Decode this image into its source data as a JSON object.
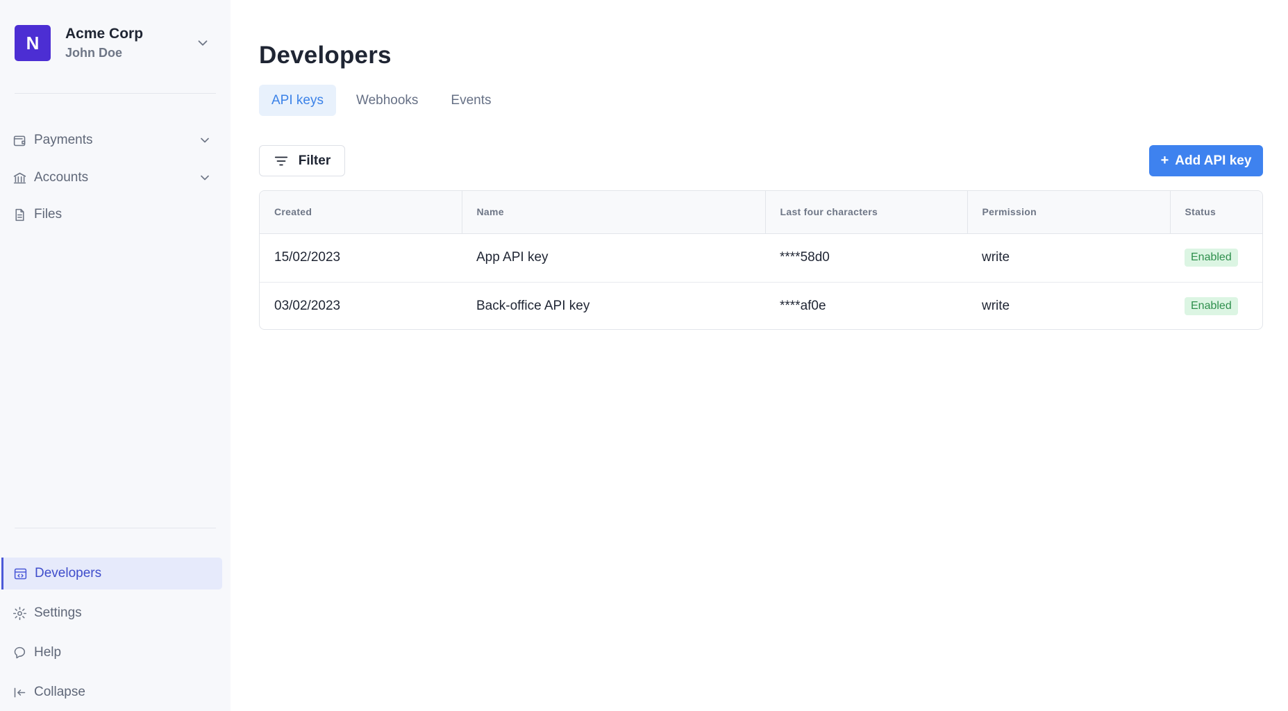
{
  "org": {
    "initial": "N",
    "name": "Acme Corp",
    "user": "John Doe"
  },
  "sidebar": {
    "items": [
      {
        "label": "Payments"
      },
      {
        "label": "Accounts"
      },
      {
        "label": "Files"
      }
    ],
    "bottom_items": [
      {
        "label": "Developers"
      },
      {
        "label": "Settings"
      },
      {
        "label": "Help"
      },
      {
        "label": "Collapse"
      }
    ]
  },
  "page": {
    "title": "Developers",
    "tabs": [
      {
        "label": "API keys"
      },
      {
        "label": "Webhooks"
      },
      {
        "label": "Events"
      }
    ]
  },
  "toolbar": {
    "filter_label": "Filter",
    "add_label": "Add API key",
    "add_icon": "+"
  },
  "table": {
    "columns": [
      "Created",
      "Name",
      "Last four characters",
      "Permission",
      "Status"
    ],
    "rows": [
      {
        "created": "15/02/2023",
        "name": "App API key",
        "last_four": "****58d0",
        "permission": "write",
        "status": "Enabled"
      },
      {
        "created": "03/02/2023",
        "name": "Back-office API key",
        "last_four": "****af0e",
        "permission": "write",
        "status": "Enabled"
      }
    ]
  },
  "colors": {
    "brand": "#4c2ed3",
    "primary": "#3e82ef",
    "active_nav": "#4b59d8",
    "status_enabled_bg": "#dcf5e3",
    "status_enabled_fg": "#2e8f4c"
  }
}
